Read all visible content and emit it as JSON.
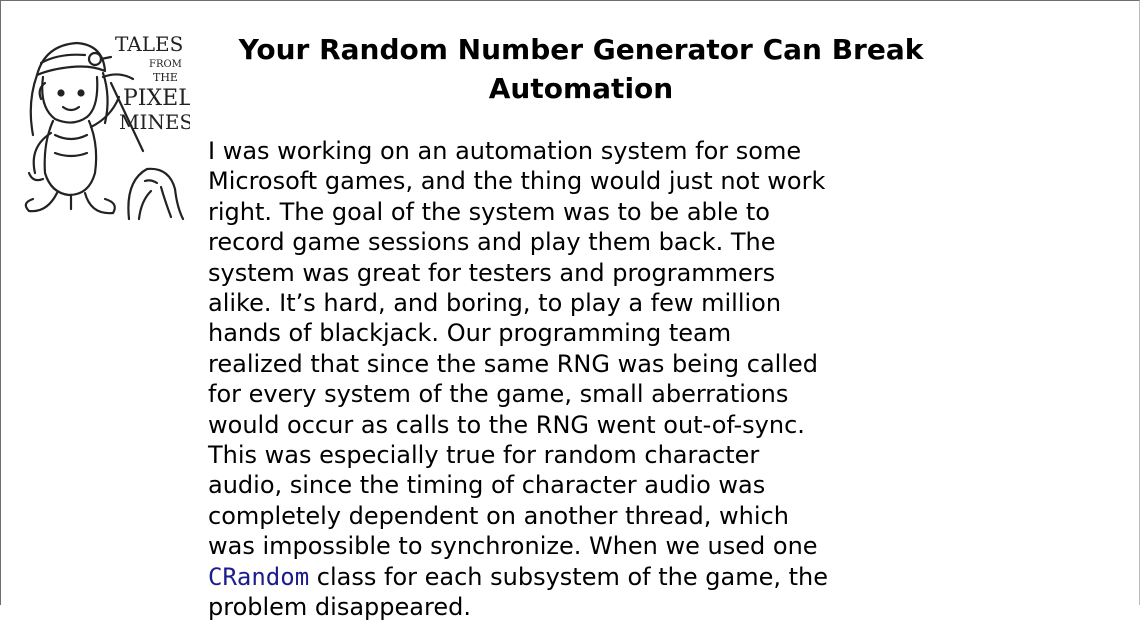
{
  "sidebar": {
    "logo": {
      "icon": "tales-from-the-pixel-mines-logo",
      "lettering": [
        "TALES",
        "FROM",
        "THE",
        "PIXEL",
        "MINES"
      ]
    },
    "title": "Your Random Number Generator Can Break Automation",
    "paragraph": {
      "text_before_code": "I was working on an automation system for some Microsoft games, and the thing would just not work right. The goal of the system was to be able to record game sessions and play them back. The system was great for testers and programmers alike. It’s hard, and boring, to play a few million hands of blackjack. Our programming team realized that since the same RNG was being called for every system of the game, small aberrations would occur as calls to the RNG went out-of-sync. This was especially true for random character audio, since the timing of character audio was completely dependent on another thread, which was impossible to synchronize. When we used one ",
      "code_term": "CRandom",
      "text_after_code": " class for each subsystem of the game, the problem disappeared."
    }
  },
  "colors": {
    "code": "#1c1c8c",
    "border": "#6e6e6e",
    "background": "#ffffff"
  }
}
